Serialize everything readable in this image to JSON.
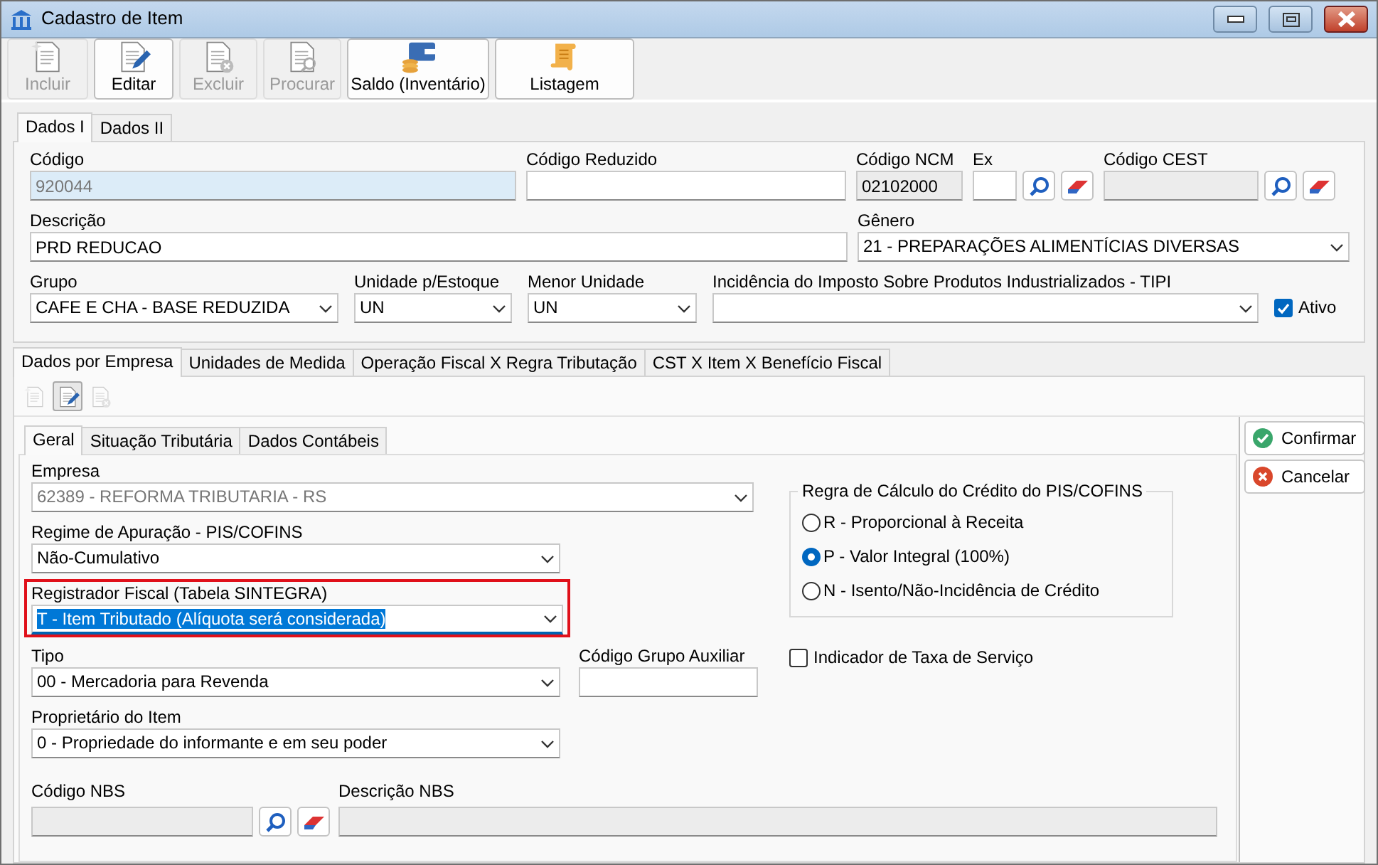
{
  "window": {
    "title": "Cadastro de Item"
  },
  "toolbar": [
    {
      "label": "Incluir",
      "kind": "new",
      "disabled": true
    },
    {
      "label": "Editar",
      "kind": "edit",
      "disabled": false
    },
    {
      "label": "Excluir",
      "kind": "delete",
      "disabled": true
    },
    {
      "label": "Procurar",
      "kind": "find",
      "disabled": true
    },
    {
      "label": "Saldo (Inventário)",
      "kind": "balance",
      "disabled": false
    },
    {
      "label": "Listagem",
      "kind": "list",
      "disabled": false
    }
  ],
  "main_tabs": [
    {
      "label": "Dados I",
      "selected": true
    },
    {
      "label": "Dados II",
      "selected": false
    }
  ],
  "header_rows": [
    [
      {
        "label": "Código",
        "kind": "text",
        "value": "920044",
        "locked": true
      },
      {
        "label": "Código Reduzido",
        "kind": "text"
      },
      {
        "label": "Código NCM",
        "kind": "text",
        "value": "02102000",
        "readonly": true
      },
      {
        "label": "Ex",
        "kind": "text",
        "lookup": true
      },
      {
        "label": "Código CEST",
        "kind": "text",
        "readonly": true,
        "lookup": true
      }
    ],
    [
      {
        "label": "Descrição",
        "kind": "text",
        "value": "PRD REDUCAO"
      },
      {
        "label": "Gênero",
        "kind": "select",
        "value": "21 - PREPARAÇÕES ALIMENTÍCIAS DIVERSAS"
      }
    ],
    [
      {
        "label": "Grupo",
        "kind": "select",
        "value": "CAFE E CHA - BASE REDUZIDA"
      },
      {
        "label": "Unidade p/Estoque",
        "kind": "select",
        "value": "UN"
      },
      {
        "label": "Menor Unidade",
        "kind": "select",
        "value": "UN"
      },
      {
        "label": "Incidência do Imposto Sobre Produtos Industrializados - TIPI",
        "kind": "select"
      },
      {
        "label": "Ativo",
        "kind": "checkbox",
        "checked": true
      }
    ]
  ],
  "company_tabs": [
    {
      "label": "Dados por Empresa",
      "selected": true
    },
    {
      "label": "Unidades de Medida",
      "selected": false
    },
    {
      "label": "Operação Fiscal X Regra Tributação",
      "selected": false
    },
    {
      "label": "CST X Item X Benefício Fiscal",
      "selected": false
    }
  ],
  "detail_toolbar": [
    {
      "kind": "new",
      "disabled": true
    },
    {
      "kind": "edit",
      "disabled": false
    },
    {
      "kind": "delete",
      "disabled": true
    }
  ],
  "inner_tabs": [
    {
      "label": "Geral",
      "selected": true
    },
    {
      "label": "Situação Tributária",
      "selected": false
    },
    {
      "label": "Dados Contábeis",
      "selected": false
    }
  ],
  "general": {
    "fields": [
      [
        {
          "label": "Empresa",
          "kind": "select",
          "value": "62389 - REFORMA TRIBUTARIA - RS",
          "disabled": true
        }
      ],
      [
        {
          "label": "Regime de Apuração - PIS/COFINS",
          "kind": "select",
          "value": "Não-Cumulativo"
        }
      ],
      [
        {
          "label": "Registrador Fiscal (Tabela SINTEGRA)",
          "kind": "select",
          "value": "T - Item Tributado (Alíquota será considerada)",
          "text_selected": true,
          "outlined": true
        }
      ],
      [
        {
          "label": "Tipo",
          "kind": "select",
          "value": "00 - Mercadoria para Revenda"
        },
        {
          "label": "Código Grupo Auxiliar",
          "kind": "text"
        }
      ],
      [
        {
          "label": "Proprietário do Item",
          "kind": "select",
          "value": "0 - Propriedade do informante e em seu poder"
        }
      ]
    ],
    "credit_rule": {
      "title": "Regra de Cálculo do Crédito do PIS/COFINS",
      "options": [
        {
          "label": "R - Proporcional à Receita",
          "selected": false
        },
        {
          "label": "P - Valor Integral (100%)",
          "selected": true
        },
        {
          "label": "N - Isento/Não-Incidência de Crédito",
          "selected": false
        }
      ]
    },
    "service_fee": {
      "label": "Indicador de Taxa de Serviço",
      "checked": false
    },
    "nbs": [
      {
        "label": "Código NBS",
        "kind": "text",
        "readonly": true,
        "lookup": true
      },
      {
        "label": "Descrição NBS",
        "kind": "text",
        "readonly": true
      }
    ]
  },
  "actions": [
    {
      "label": "Confirmar",
      "kind": "confirm"
    },
    {
      "label": "Cancelar",
      "kind": "cancel"
    }
  ]
}
